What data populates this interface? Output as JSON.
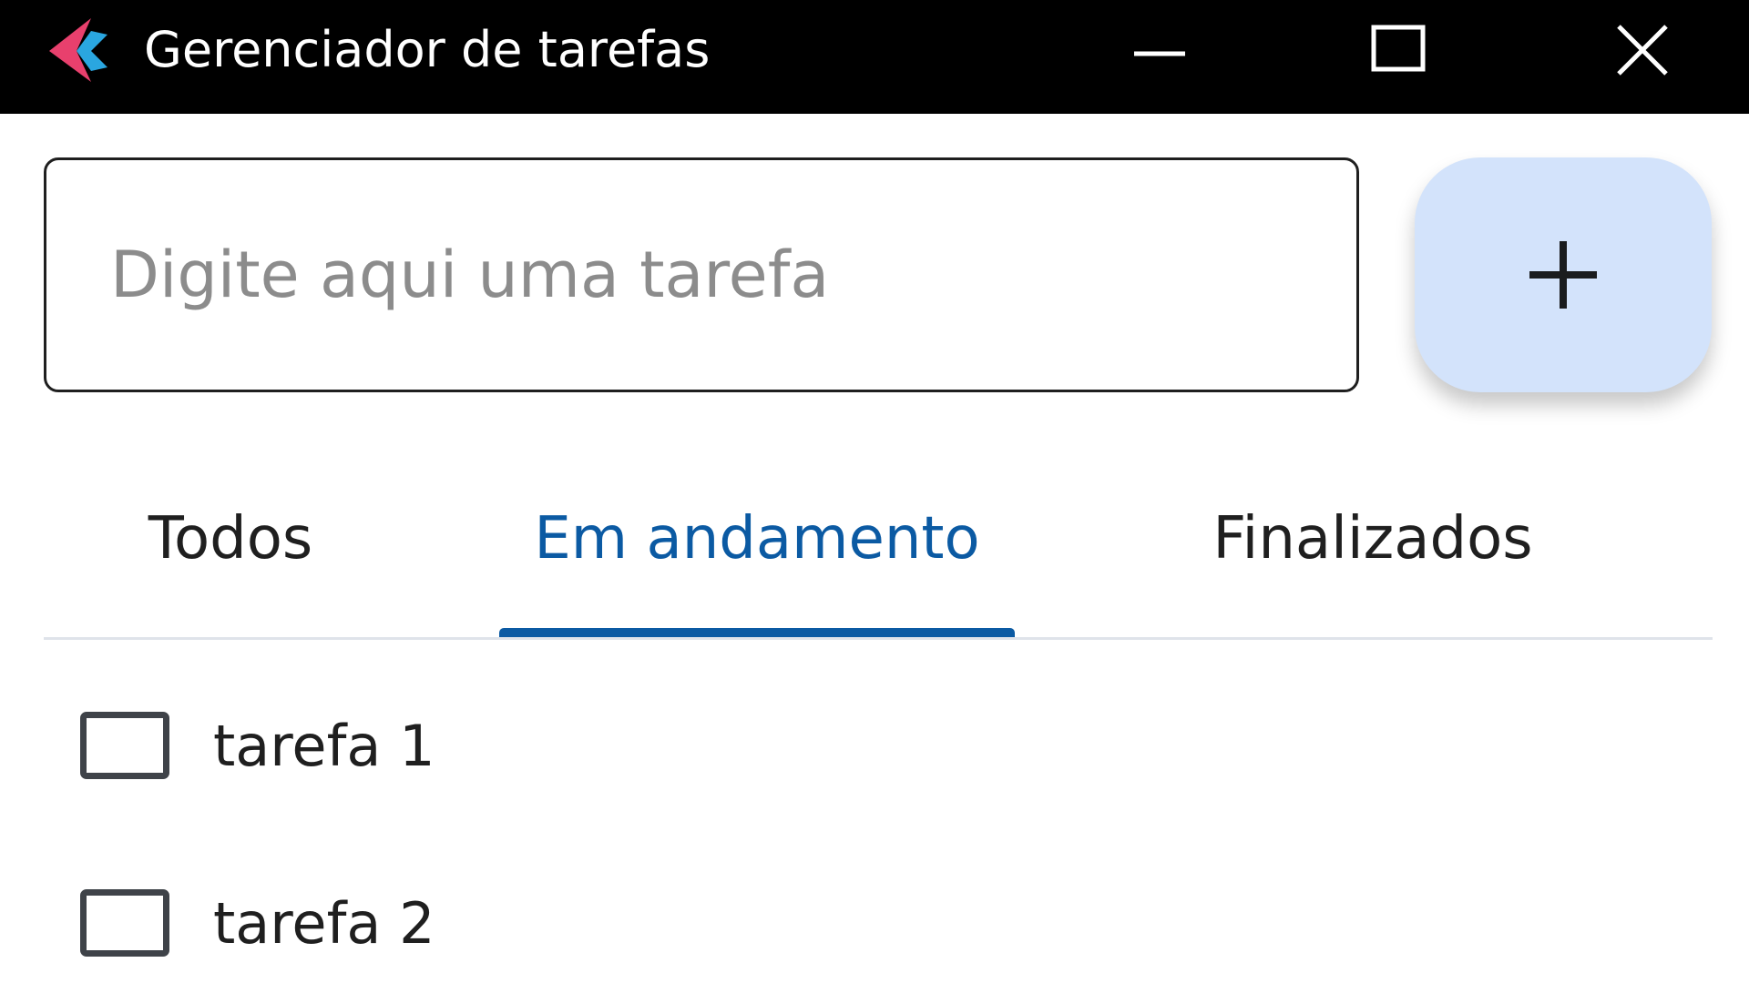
{
  "window": {
    "title": "Gerenciador de tarefas",
    "icons": {
      "app": "app-logo-icon",
      "minimize": "minimize-icon",
      "maximize": "maximize-icon",
      "close": "close-icon"
    }
  },
  "input": {
    "placeholder": "Digite aqui uma tarefa",
    "value": ""
  },
  "add_button": {
    "icon": "plus-icon",
    "background": "#d3e3fb"
  },
  "tabs": [
    {
      "label": "Todos",
      "active": false
    },
    {
      "label": "Em andamento",
      "active": true
    },
    {
      "label": "Finalizados",
      "active": false
    }
  ],
  "tasks": [
    {
      "label": "tarefa 1",
      "checked": false
    },
    {
      "label": "tarefa 2",
      "checked": false
    }
  ],
  "colors": {
    "titlebar": "#000000",
    "accent": "#0b5aa3",
    "add_button": "#d3e3fb",
    "logo_pink": "#e8406d",
    "logo_blue": "#2aa6e0"
  }
}
